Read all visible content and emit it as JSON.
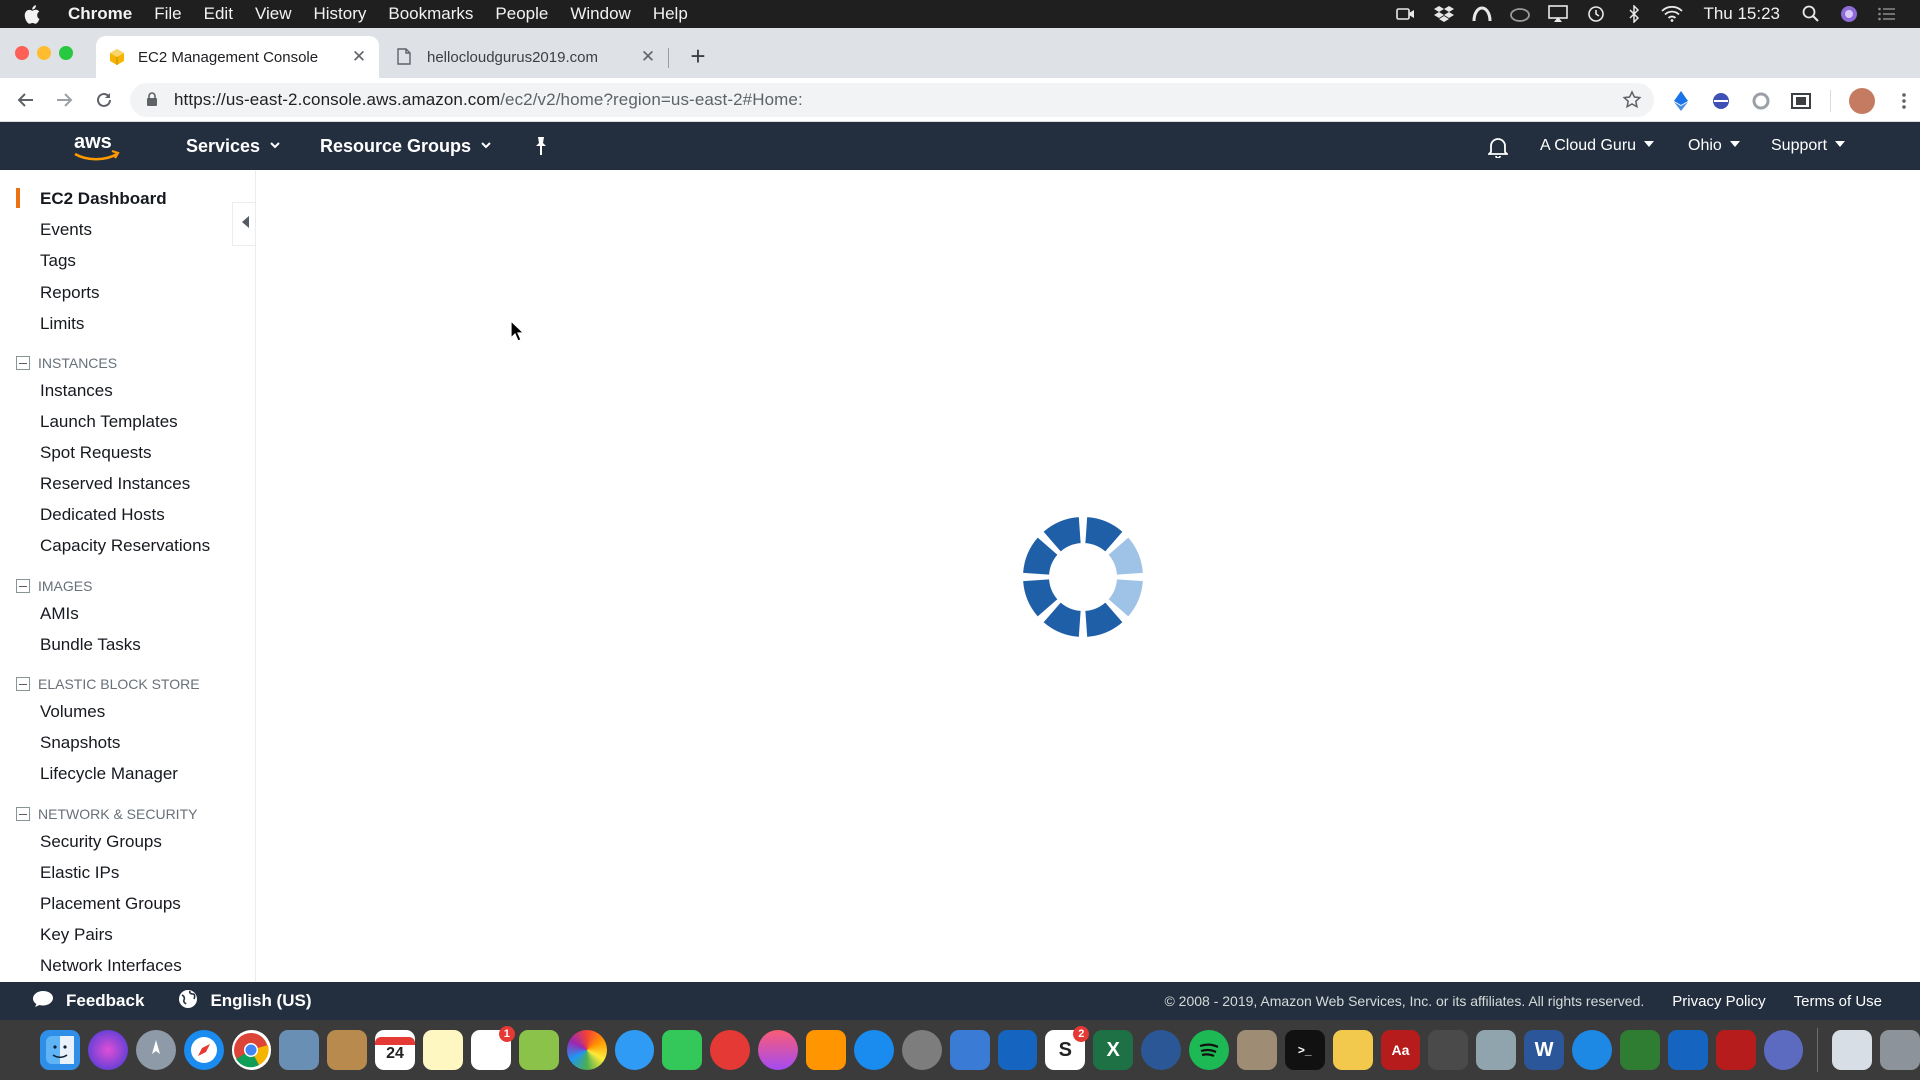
{
  "mac_menubar": {
    "app_name": "Chrome",
    "menus": [
      "File",
      "Edit",
      "View",
      "History",
      "Bookmarks",
      "People",
      "Window",
      "Help"
    ],
    "clock": "Thu 15:23"
  },
  "browser": {
    "tabs": [
      {
        "title": "EC2 Management Console",
        "active": true
      },
      {
        "title": "hellocloudgurus2019.com",
        "active": false
      }
    ],
    "url_host": "https://us-east-2.console.aws.amazon.com",
    "url_path": "/ec2/v2/home?region=us-east-2#Home:"
  },
  "aws_nav": {
    "services_label": "Services",
    "resource_groups_label": "Resource Groups",
    "account_label": "A Cloud Guru",
    "region_label": "Ohio",
    "support_label": "Support"
  },
  "sidebar": {
    "top_items": [
      {
        "label": "EC2 Dashboard",
        "active": true
      },
      {
        "label": "Events"
      },
      {
        "label": "Tags"
      },
      {
        "label": "Reports"
      },
      {
        "label": "Limits"
      }
    ],
    "sections": [
      {
        "title": "INSTANCES",
        "items": [
          "Instances",
          "Launch Templates",
          "Spot Requests",
          "Reserved Instances",
          "Dedicated Hosts",
          "Capacity Reservations"
        ]
      },
      {
        "title": "IMAGES",
        "items": [
          "AMIs",
          "Bundle Tasks"
        ]
      },
      {
        "title": "ELASTIC BLOCK STORE",
        "items": [
          "Volumes",
          "Snapshots",
          "Lifecycle Manager"
        ]
      },
      {
        "title": "NETWORK & SECURITY",
        "items": [
          "Security Groups",
          "Elastic IPs",
          "Placement Groups",
          "Key Pairs",
          "Network Interfaces"
        ]
      }
    ]
  },
  "main": {
    "loading": true
  },
  "footer": {
    "feedback_label": "Feedback",
    "language_label": "English (US)",
    "copyright": "© 2008 - 2019, Amazon Web Services, Inc. or its affiliates. All rights reserved.",
    "privacy_label": "Privacy Policy",
    "terms_label": "Terms of Use"
  },
  "dock": {
    "calendar_day": "24",
    "badge_one": "1",
    "badge_two": "2"
  },
  "colors": {
    "aws_nav_bg": "#232f3e",
    "accent_orange": "#ec7211",
    "spinner_dark": "#1f5fa8",
    "spinner_light": "#9fc3e7"
  }
}
